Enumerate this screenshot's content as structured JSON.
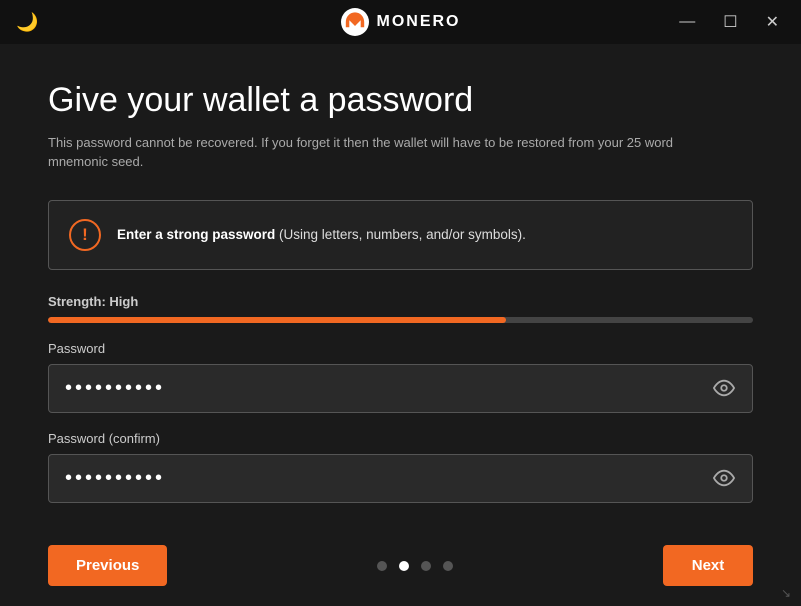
{
  "titlebar": {
    "app_name": "MONERO",
    "minimize_label": "—",
    "maximize_label": "☐",
    "close_label": "✕",
    "moon_icon": "🌙"
  },
  "page": {
    "title": "Give your wallet a password",
    "subtitle": "This password cannot be recovered. If you forget it then the wallet will have to be restored from your 25 word mnemonic seed.",
    "warning_text_bold": "Enter a strong password",
    "warning_text_rest": " (Using letters, numbers, and/or symbols).",
    "strength_label": "Strength: High",
    "strength_percent": 65,
    "password_label": "Password",
    "password_value": "••••••••••",
    "confirm_label": "Password (confirm)",
    "confirm_value": "••••••••••"
  },
  "navigation": {
    "previous_label": "Previous",
    "next_label": "Next"
  },
  "pagination": {
    "dots": [
      {
        "active": false
      },
      {
        "active": true
      },
      {
        "active": false
      },
      {
        "active": false
      }
    ]
  }
}
